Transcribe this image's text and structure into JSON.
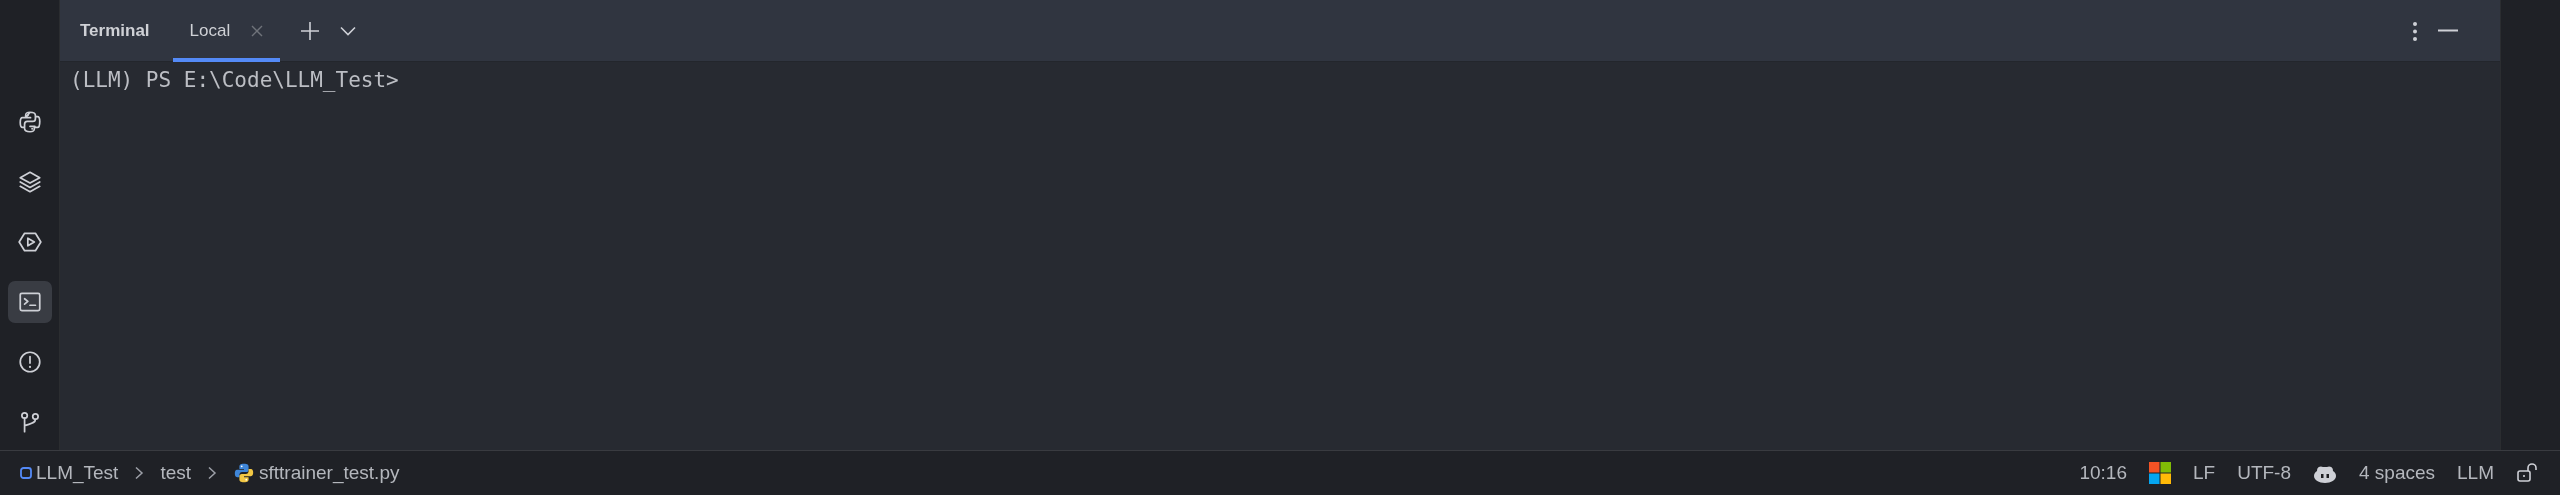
{
  "sidebar": {
    "items": [
      {
        "kind": "python",
        "selected": false
      },
      {
        "kind": "layers",
        "selected": false
      },
      {
        "kind": "run",
        "selected": false
      },
      {
        "kind": "terminal",
        "selected": true
      },
      {
        "kind": "problems",
        "selected": false
      },
      {
        "kind": "git",
        "selected": false
      }
    ]
  },
  "tool_window": {
    "title": "Terminal",
    "tabs": [
      {
        "label": "Local",
        "selected": true
      }
    ]
  },
  "terminal": {
    "lines": [
      "(LLM) PS E:\\Code\\LLM_Test>"
    ]
  },
  "status_bar": {
    "breadcrumb": [
      {
        "kind": "project",
        "label": "LLM_Test"
      },
      {
        "kind": "folder",
        "label": "test"
      },
      {
        "kind": "python",
        "label": "sfttrainer_test.py"
      }
    ],
    "items": [
      {
        "kind": "text",
        "label": "10:16"
      },
      {
        "kind": "windows"
      },
      {
        "kind": "text",
        "label": "LF"
      },
      {
        "kind": "text",
        "label": "UTF-8"
      },
      {
        "kind": "robot"
      },
      {
        "kind": "text",
        "label": "4 spaces"
      },
      {
        "kind": "text",
        "label": "LLM"
      },
      {
        "kind": "lock"
      }
    ]
  }
}
